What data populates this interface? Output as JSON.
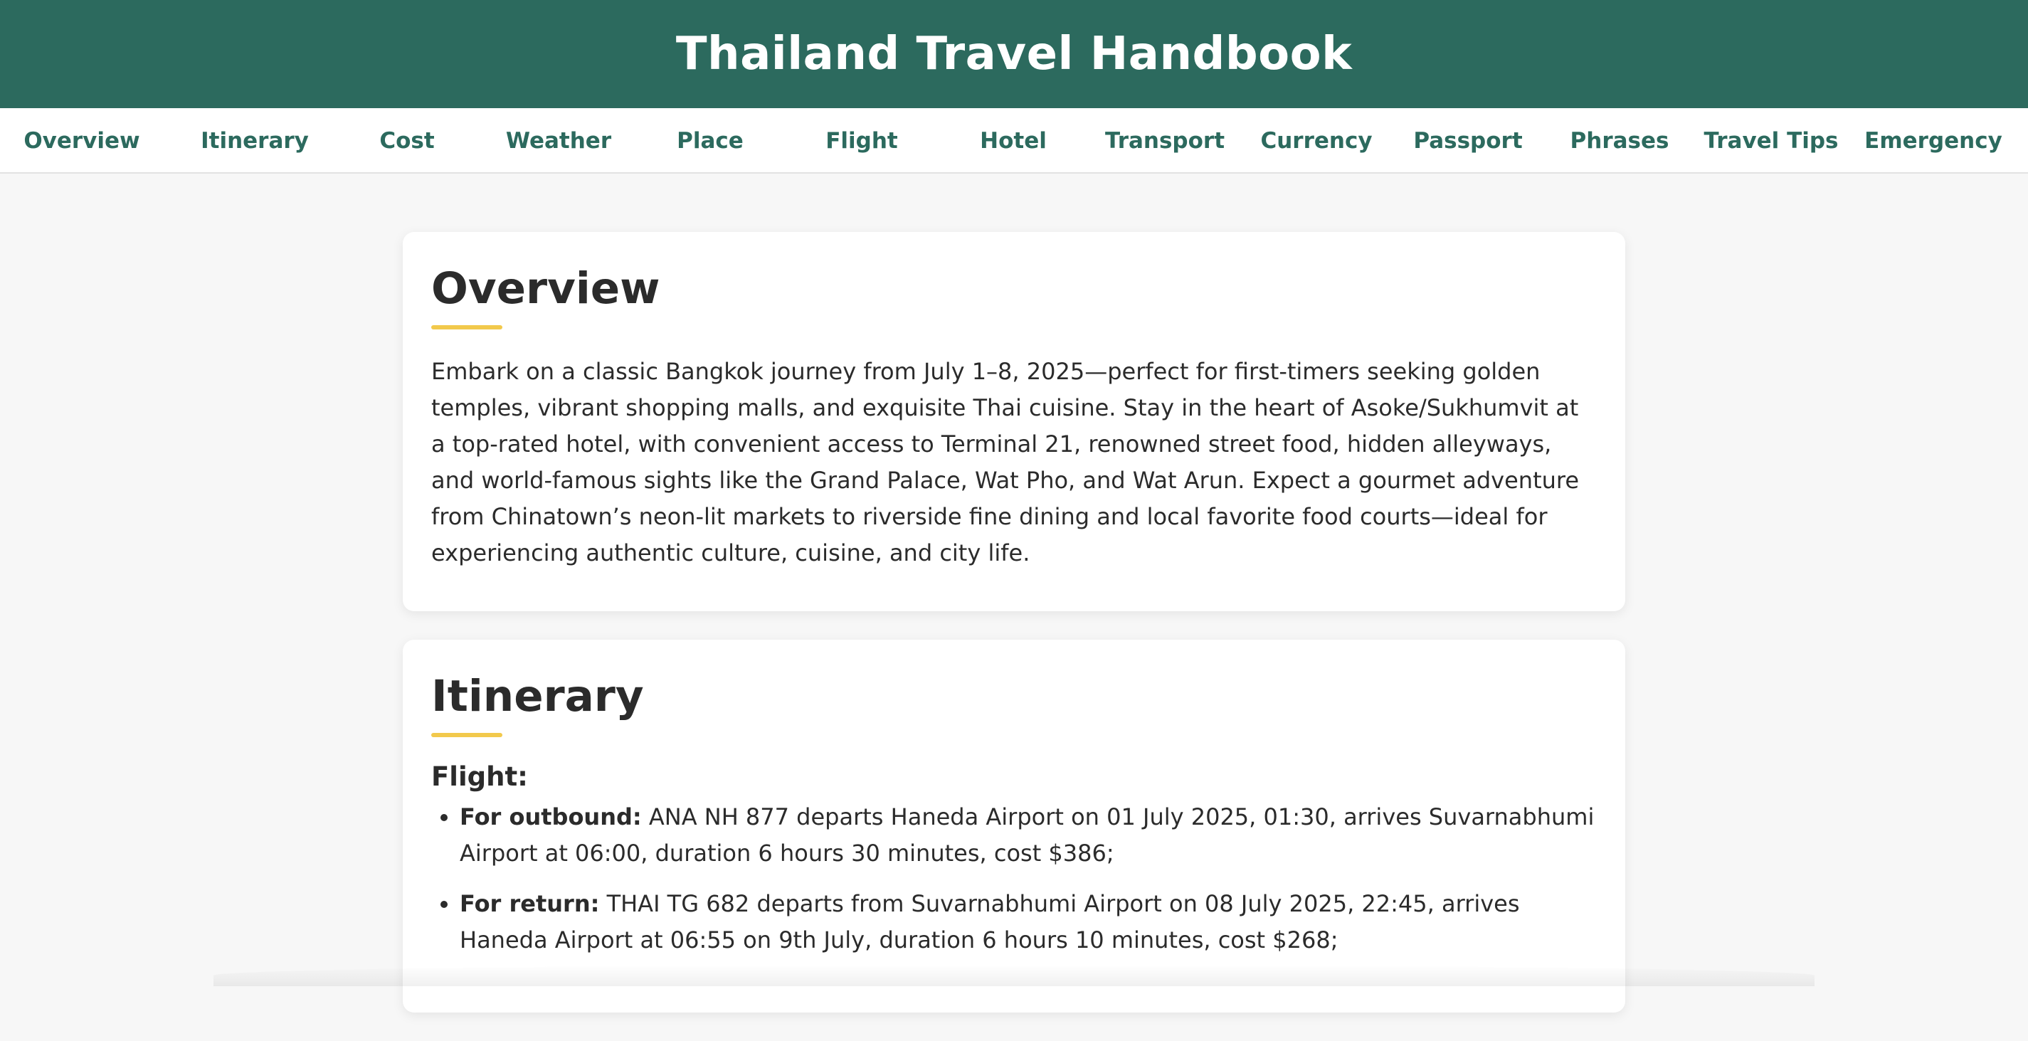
{
  "header": {
    "title": "Thailand Travel Handbook"
  },
  "nav": [
    "Overview",
    "Itinerary",
    "Cost",
    "Weather",
    "Place",
    "Flight",
    "Hotel",
    "Transport",
    "Currency",
    "Passport",
    "Phrases",
    "Travel Tips",
    "Emergency"
  ],
  "overview": {
    "title": "Overview",
    "body": "Embark on a classic Bangkok journey from July 1–8, 2025—perfect for first-timers seeking golden temples, vibrant shopping malls, and exquisite Thai cuisine. Stay in the heart of Asoke/Sukhumvit at a top-rated hotel, with convenient access to Terminal 21, renowned street food, hidden alleyways, and world-famous sights like the Grand Palace, Wat Pho, and Wat Arun. Expect a gourmet adventure from Chinatown’s neon-lit markets to riverside fine dining and local favorite food courts—ideal for experiencing authentic culture, cuisine, and city life."
  },
  "itinerary": {
    "title": "Itinerary",
    "flight_heading": "Flight:",
    "items": [
      {
        "label": "For outbound:",
        "text": " ANA NH 877 departs Haneda Airport on 01 July 2025, 01:30, arrives Suvarnabhumi Airport at 06:00, duration 6 hours 30 minutes, cost $386;"
      },
      {
        "label": "For return:",
        "text": " THAI TG 682 departs from Suvarnabhumi Airport on 08 July 2025, 22:45, arrives Haneda Airport at 06:55 on 9th July, duration 6 hours 10 minutes, cost $268;"
      }
    ]
  },
  "colors": {
    "brand": "#2c6a5e",
    "accent": "#f2c94c",
    "page_bg": "#f7f7f7"
  }
}
